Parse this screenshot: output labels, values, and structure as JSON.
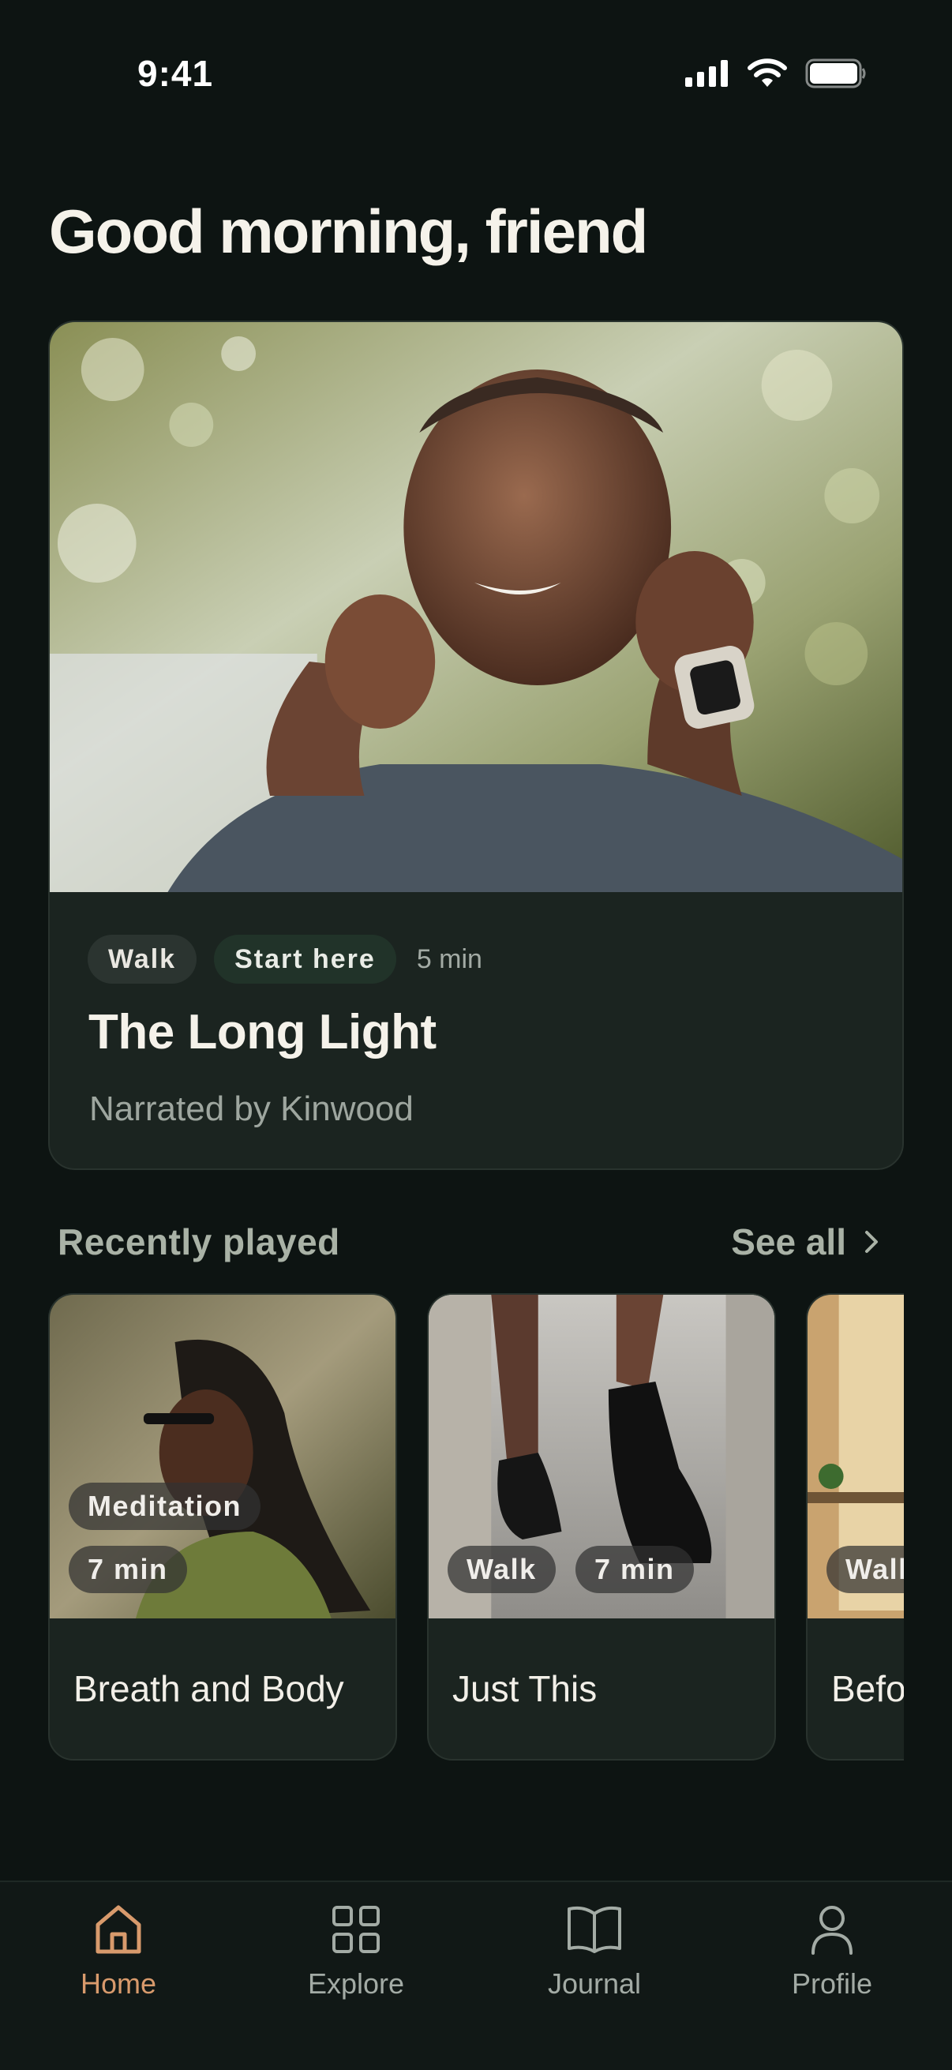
{
  "status_bar": {
    "time": "9:41"
  },
  "greeting": "Good morning, friend",
  "featured": {
    "tags": [
      "Walk",
      "Start here"
    ],
    "duration": "5 min",
    "title": "The Long Light",
    "narrator": "Narrated by Kinwood"
  },
  "recent": {
    "title": "Recently played",
    "see_all": "See all",
    "items": [
      {
        "chips": [
          "Meditation",
          "7 min"
        ],
        "title": "Breath and Body"
      },
      {
        "chips": [
          "Walk",
          "7 min"
        ],
        "title": "Just This"
      },
      {
        "chips": [
          "Walk"
        ],
        "title": "Before Start"
      }
    ]
  },
  "nav": {
    "items": [
      {
        "label": "Home",
        "icon": "home-icon",
        "active": true
      },
      {
        "label": "Explore",
        "icon": "grid-icon",
        "active": false
      },
      {
        "label": "Journal",
        "icon": "book-icon",
        "active": false
      },
      {
        "label": "Profile",
        "icon": "person-icon",
        "active": false
      }
    ]
  },
  "colors": {
    "background": "#0d1412",
    "card": "#1b2420",
    "accent": "#d89a6c",
    "muted_text": "#a3aba5"
  }
}
